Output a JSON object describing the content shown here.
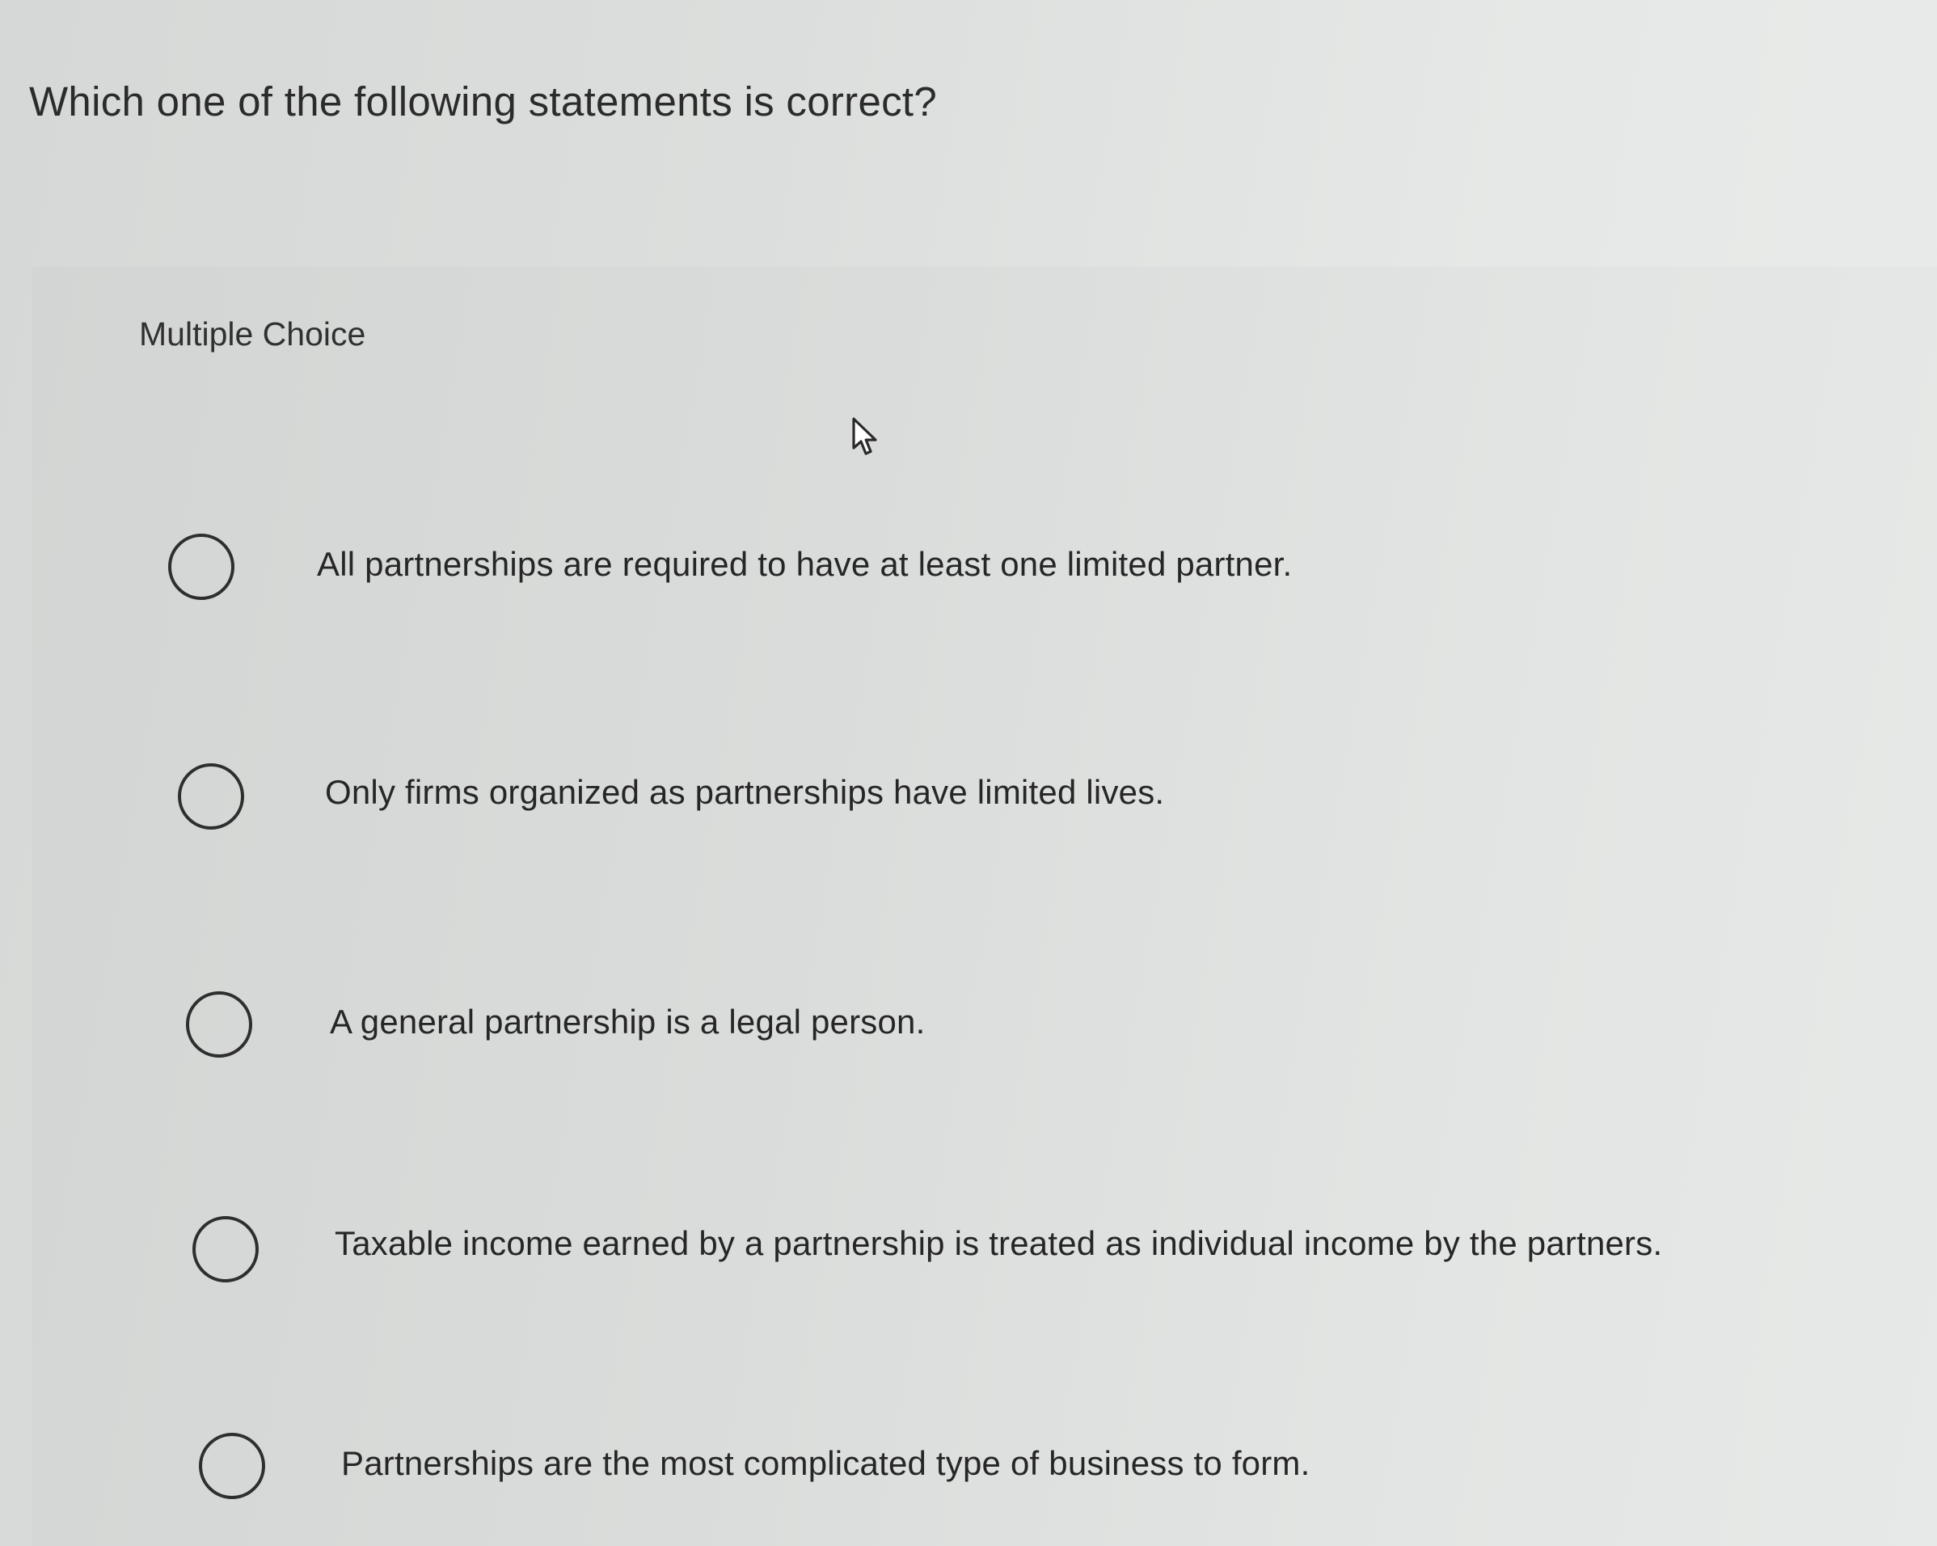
{
  "question": {
    "text": "Which one of the following statements is correct?"
  },
  "section": {
    "label": "Multiple Choice"
  },
  "options": [
    {
      "label": "All partnerships are required to have at least one limited partner."
    },
    {
      "label": "Only firms organized as partnerships have limited lives."
    },
    {
      "label": "A general partnership is a legal person."
    },
    {
      "label": "Taxable income earned by a partnership is treated as individual income by the partners."
    },
    {
      "label": "Partnerships are the most complicated type of business to form."
    }
  ],
  "icons": {
    "cursor": "mouse-pointer-icon",
    "radio": "radio-unchecked-icon"
  }
}
